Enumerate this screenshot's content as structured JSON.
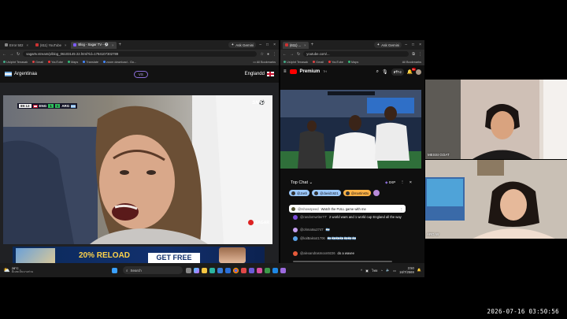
{
  "left_browser": {
    "tabs": [
      {
        "label": "Error 502",
        "active": false
      },
      {
        "label": "(611) YouTube",
        "active": false
      },
      {
        "label": "Blog - Sagar TV - ⚽",
        "active": true
      }
    ],
    "ask_gemini": "Ask Gemini",
    "url": "sagartv.stream/p/blog_06103145 22.html?id=1784107302789",
    "bookmarks": [
      "UsIpInt Tenasak",
      "Gmail",
      "YouTube",
      "Maps",
      "Translate",
      "zoom download - Go..."
    ],
    "all_bookmarks": "All Bookmarks",
    "site": {
      "team_left": "Argentinaa",
      "vs": "VS",
      "team_right": "Englandd"
    },
    "scorebug": {
      "time": "89:13",
      "home": "ENG",
      "home_score": "1",
      "away_score": "1",
      "away": "ARG"
    },
    "watermark": "SAGAR",
    "ad": {
      "reload": "20% RELOAD",
      "cta": "GET FREE"
    }
  },
  "right_browser": {
    "tabs": [
      {
        "label": "(611) ... ",
        "active": true
      }
    ],
    "ask_gemini": "Ask Gemini",
    "url": "youtube.com/...",
    "bookmarks": [
      "UsIpInt Tenasak",
      "Gmail",
      "YouTube",
      "Maps",
      "Translate"
    ],
    "all_bookmarks": "All Bookmarks",
    "yt_logo": "Premium",
    "yt_region": "TH",
    "create_label": "สร้าง",
    "notif_count": "9+",
    "chat": {
      "title": "Top Chat",
      "points": "0XP",
      "pinned_users": [
        "@Jash",
        "@david1621",
        "@martins0x"
      ],
      "pinned_msg_user": "@Ishowspeed",
      "pinned_msg_text": "Watch the FULL game with me",
      "messages": [
        {
          "user": "@randomwriterYT",
          "text": "2 world wars and 1 world cup England all the way",
          "color": "#7a4ad8"
        },
        {
          "user": "@ohmatsu2747",
          "text": "🇦🇷",
          "color": "#c6a0f0"
        },
        {
          "user": "@kalBaksot1706",
          "text": "🇦🇷🇦🇷🇦🇷🇦🇷🇦🇷🇦🇷🇦🇷",
          "color": "#5aa1e6"
        },
        {
          "user": "@alexandrasmoon9226",
          "text": "do a wavee",
          "color": "#e65a3a"
        }
      ]
    }
  },
  "taskbar": {
    "weather_temp": "28°C",
    "weather_desc": "มีเมฆเป็นบางส่วน",
    "search": "Search",
    "lang": "ไทย",
    "time": "3:50",
    "date": "16/7/2569"
  },
  "cams": {
    "top_name": "MESSI GOAT",
    "bottom_name": "ARG W"
  },
  "recording_timestamp": "2026-07-16 03:50:56"
}
